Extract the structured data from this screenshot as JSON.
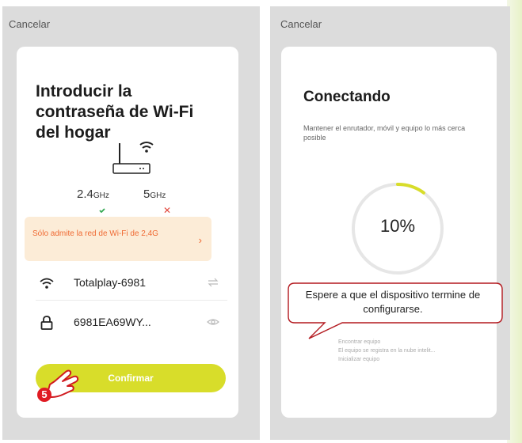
{
  "left_screen": {
    "cancel_label": "Cancelar",
    "title": "Introducir la\ncontraseña de Wi-Fi\ndel hogar",
    "band_a": "2.4",
    "band_a_unit": "GHz",
    "band_b": "5",
    "band_b_unit": "GHz",
    "band_b_mark": "✕",
    "warning": "Sólo admite la red de Wi-Fi de 2,4G",
    "ssid": "Totalplay-6981",
    "password": "6981EA69WY...",
    "confirm_label": "Confirmar",
    "step_badge": "5"
  },
  "right_screen": {
    "cancel_label": "Cancelar",
    "title": "Conectando",
    "subtitle": "Mantener el enrutador, móvil y equipo lo más cerca posible",
    "progress_label": "10%",
    "progress_fraction": 0.1,
    "steps": [
      "Encontrar equipo",
      "El equipo se registra en la nube intelit...",
      "Inicializar equipo"
    ]
  },
  "callout": {
    "text": "Espere a que el dispositivo termine de configurarse."
  },
  "colors": {
    "accent": "#d8dd2a",
    "warning_bg": "#fcecd7",
    "warning_text": "#ef6a33",
    "progress": "#d8dd2a",
    "badge": "#e01b23",
    "callout_border": "#b3191f"
  }
}
